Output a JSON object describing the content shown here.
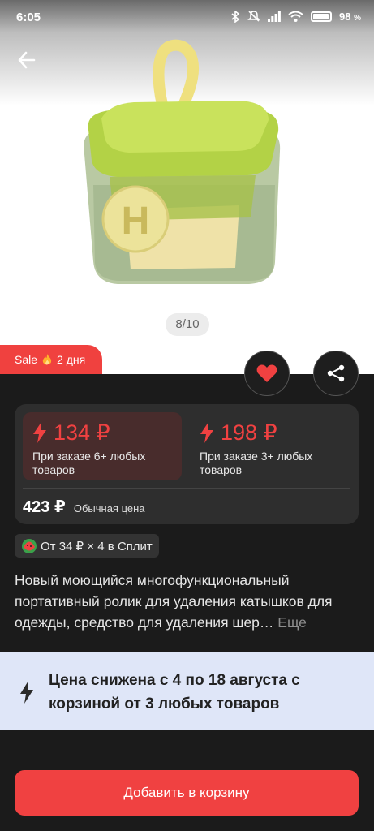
{
  "status_bar": {
    "time": "6:05",
    "battery": "98",
    "battery_unit": "%"
  },
  "gallery": {
    "counter": "8/10"
  },
  "sale_badge": {
    "label": "Sale",
    "duration": "2 дня"
  },
  "prices": [
    {
      "value": "134 ₽",
      "note": "При заказе 6+ любых товаров",
      "selected": true
    },
    {
      "value": "198 ₽",
      "note": "При заказе 3+ любых товаров",
      "selected": false
    }
  ],
  "regular_price": {
    "value": "423 ₽",
    "label": "Обычная цена"
  },
  "split": {
    "label": "От 34 ₽ × 4 в Сплит"
  },
  "description": {
    "text": "Новый моющийся многофункциональный портативный ролик для удаления катышков для одежды, средство для удаления шер…",
    "more": "Еще"
  },
  "promo": {
    "text": "Цена снижена с 4 по 18 августа с корзиной от 3 любых товаров"
  },
  "cart_button": {
    "label": "Добавить в корзину"
  },
  "colors": {
    "accent": "#f04141",
    "dark_bg": "#1b1b1b",
    "card_bg": "#2e2e2e",
    "promo_bg": "#dfe6f8"
  },
  "icons": [
    "back-arrow-icon",
    "bluetooth-icon",
    "mute-icon",
    "signal-icon",
    "wifi-icon",
    "battery-icon",
    "heart-icon",
    "share-icon",
    "lightning-icon",
    "fire-icon",
    "split-logo-icon"
  ]
}
